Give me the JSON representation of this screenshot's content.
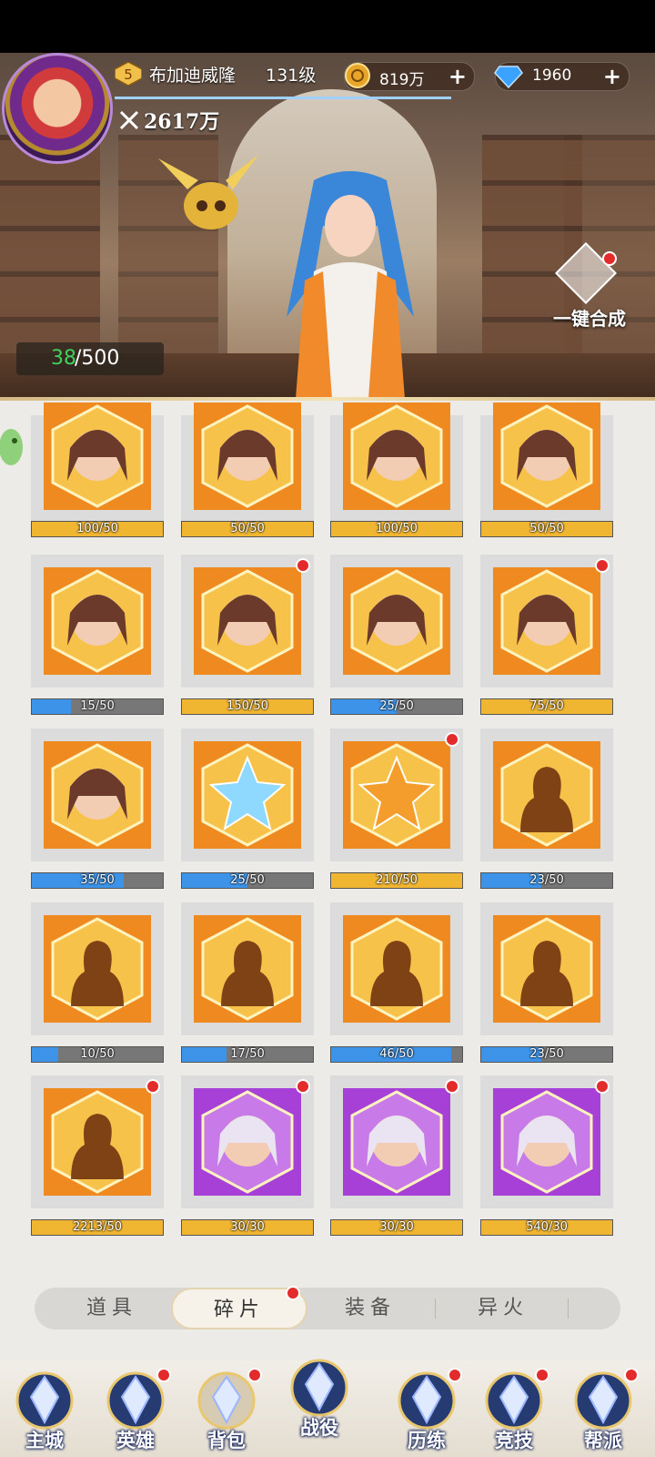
{
  "header": {
    "vip_level": "5",
    "player_name": "布加迪威隆",
    "player_level": "131级",
    "combat_power": "2617万",
    "gold": "819万",
    "gems": "1960",
    "plus": "+"
  },
  "capacity": {
    "used": "38",
    "total": "/500"
  },
  "one_click_label": "一键合成",
  "fragments": [
    {
      "name": "moon-hero-dark-hair",
      "progress": "100/50",
      "ratio": 1.0,
      "color": "gold",
      "badge": false,
      "portrait": "hero-portrait"
    },
    {
      "name": "sun-hero-red-hair",
      "progress": "50/50",
      "ratio": 1.0,
      "color": "gold",
      "badge": false,
      "portrait": "hero-portrait"
    },
    {
      "name": "sun-hero-old-man",
      "progress": "100/50",
      "ratio": 1.0,
      "color": "gold",
      "badge": false,
      "portrait": "hero-portrait"
    },
    {
      "name": "sun-hero-brown-hair",
      "progress": "50/50",
      "ratio": 1.0,
      "color": "gold",
      "badge": false,
      "portrait": "hero-portrait"
    },
    {
      "name": "wind-hero-red-hair",
      "progress": "15/50",
      "ratio": 0.3,
      "color": "blue",
      "badge": false,
      "portrait": "hero-portrait"
    },
    {
      "name": "wind-hero-dark-hair",
      "progress": "150/50",
      "ratio": 1.0,
      "color": "gold",
      "badge": true,
      "portrait": "hero-portrait"
    },
    {
      "name": "fire-hero-pink-hair",
      "progress": "25/50",
      "ratio": 0.5,
      "color": "blue",
      "badge": false,
      "portrait": "hero-portrait"
    },
    {
      "name": "water-hero-purple-hair",
      "progress": "75/50",
      "ratio": 1.0,
      "color": "gold",
      "badge": true,
      "portrait": "hero-portrait"
    },
    {
      "name": "water-hero-blue-hair",
      "progress": "35/50",
      "ratio": 0.7,
      "color": "blue",
      "badge": false,
      "portrait": "hero-portrait"
    },
    {
      "name": "rainbow-star-crystal",
      "progress": "25/50",
      "ratio": 0.5,
      "color": "blue",
      "badge": false,
      "portrait": "star-crystal"
    },
    {
      "name": "orange-star-crystal",
      "progress": "210/50",
      "ratio": 1.0,
      "color": "gold",
      "badge": true,
      "portrait": "star-crystal"
    },
    {
      "name": "mystery-hero-dark",
      "progress": "23/50",
      "ratio": 0.46,
      "color": "blue",
      "badge": false,
      "portrait": "silhouette"
    },
    {
      "name": "moon-silhouette",
      "progress": "10/50",
      "ratio": 0.2,
      "color": "blue",
      "badge": false,
      "portrait": "silhouette"
    },
    {
      "name": "wind-silhouette",
      "progress": "17/50",
      "ratio": 0.34,
      "color": "blue",
      "badge": false,
      "portrait": "silhouette"
    },
    {
      "name": "fire-silhouette",
      "progress": "46/50",
      "ratio": 0.92,
      "color": "blue",
      "badge": false,
      "portrait": "silhouette"
    },
    {
      "name": "water-silhouette",
      "progress": "23/50",
      "ratio": 0.46,
      "color": "blue",
      "badge": false,
      "portrait": "silhouette"
    },
    {
      "name": "random-silhouette",
      "progress": "2213/50",
      "ratio": 1.0,
      "color": "gold",
      "badge": true,
      "portrait": "silhouette"
    },
    {
      "name": "moon-hero-silver-hair",
      "progress": "30/30",
      "ratio": 1.0,
      "color": "gold",
      "badge": true,
      "portrait": "purple-hero"
    },
    {
      "name": "moon-hero-masked",
      "progress": "30/30",
      "ratio": 1.0,
      "color": "gold",
      "badge": true,
      "portrait": "purple-hero"
    },
    {
      "name": "sun-hero-peach-hair",
      "progress": "540/30",
      "ratio": 1.0,
      "color": "gold",
      "badge": true,
      "portrait": "purple-hero"
    }
  ],
  "tabs": [
    {
      "label": "道具",
      "active": false,
      "badge": false
    },
    {
      "label": "碎片",
      "active": true,
      "badge": true
    },
    {
      "label": "装备",
      "active": false,
      "badge": false
    },
    {
      "label": "异火",
      "active": false,
      "badge": false
    }
  ],
  "nav": [
    {
      "label": "主城",
      "icon": "castle-icon",
      "badge": false
    },
    {
      "label": "英雄",
      "icon": "hero-helmet-icon",
      "badge": true
    },
    {
      "label": "背包",
      "icon": "backpack-icon",
      "badge": true
    },
    {
      "label": "战役",
      "icon": "crossed-swords-icon",
      "badge": false
    },
    {
      "label": "历练",
      "icon": "portal-gate-icon",
      "badge": true
    },
    {
      "label": "竞技",
      "icon": "arena-trident-icon",
      "badge": true
    },
    {
      "label": "帮派",
      "icon": "guild-banner-icon",
      "badge": true
    }
  ],
  "colors": {
    "gold_bar": "#f0b531",
    "blue_bar": "#3d93e8",
    "orange_frame": "#ee8a20",
    "purple_frame": "#a640d6",
    "badge": "#e42b2b",
    "capacity_used": "#3fd15a"
  }
}
